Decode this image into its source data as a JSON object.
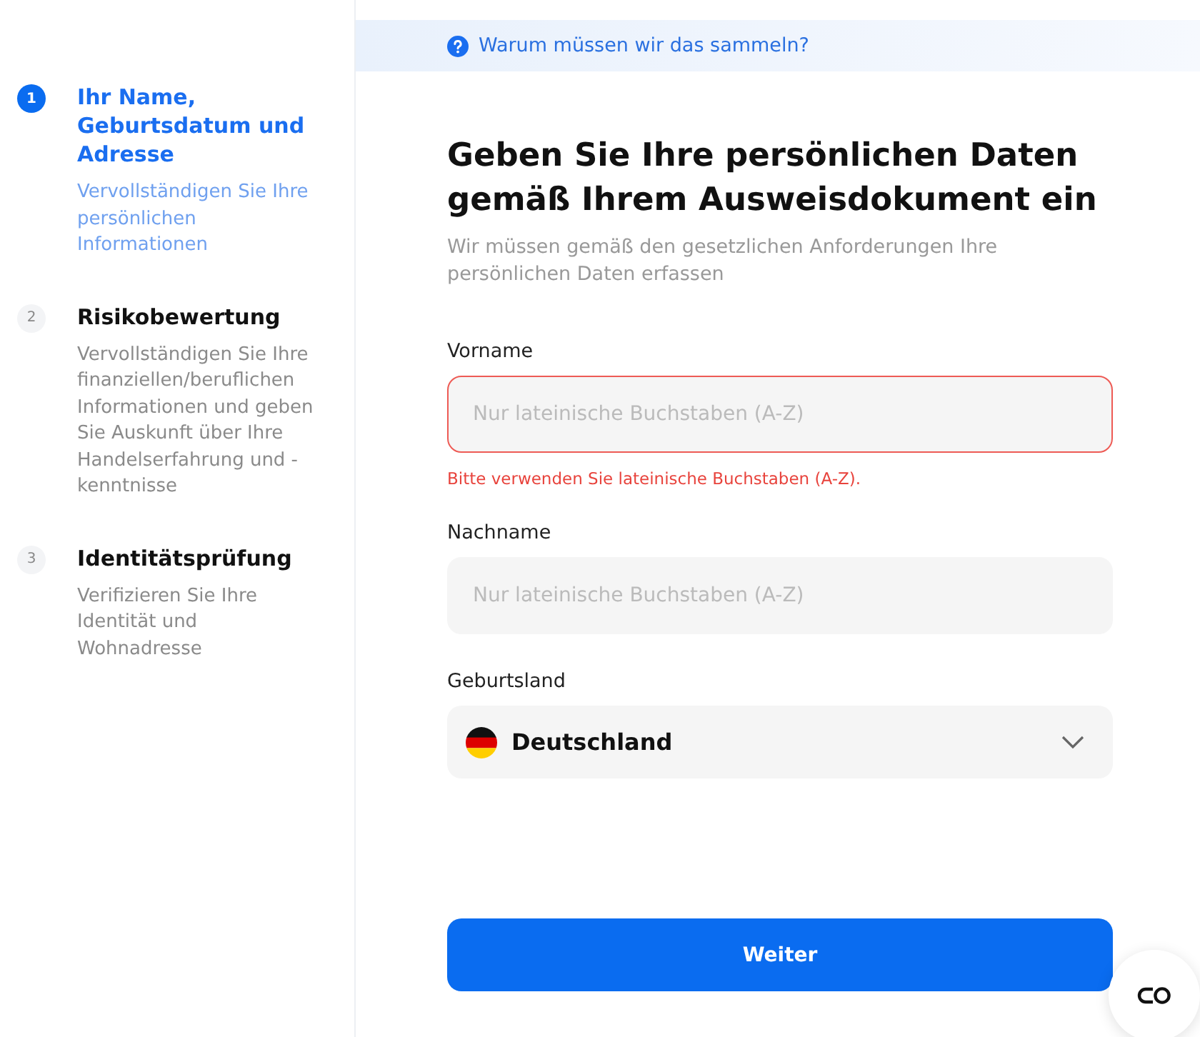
{
  "steps": [
    {
      "number": "1",
      "title": "Ihr Name, Geburtsdatum und Adresse",
      "description": "Vervollständigen Sie Ihre persönlichen Informationen",
      "selected": true
    },
    {
      "number": "2",
      "title": "Risikobewertung",
      "description": "Vervollständigen Sie Ihre finanziellen/beruflichen Informationen und geben Sie Auskunft über Ihre Handelserfahrung und -kenntnisse",
      "selected": false
    },
    {
      "number": "3",
      "title": "Identitätsprüfung",
      "description": "Verifizieren Sie Ihre Identität und Wohnadresse",
      "selected": false
    }
  ],
  "info_link": "Warum müssen wir das sammeln?",
  "heading": "Geben Sie Ihre persönlichen Daten gemäß Ihrem Ausweisdokument ein",
  "subheading": "Wir müssen gemäß den gesetzlichen Anforderungen Ihre persönlichen Daten erfassen",
  "fields": [
    {
      "kind": "text",
      "label": "Vorname",
      "placeholder": "Nur lateinische Buchstaben (A-Z)",
      "error": "Bitte verwenden Sie lateinische Buchstaben (A-Z)."
    },
    {
      "kind": "text",
      "label": "Nachname",
      "placeholder": "Nur lateinische Buchstaben (A-Z)"
    },
    {
      "kind": "select",
      "label": "Geburtsland",
      "value": "Deutschland"
    }
  ],
  "submit_button": "Weiter"
}
